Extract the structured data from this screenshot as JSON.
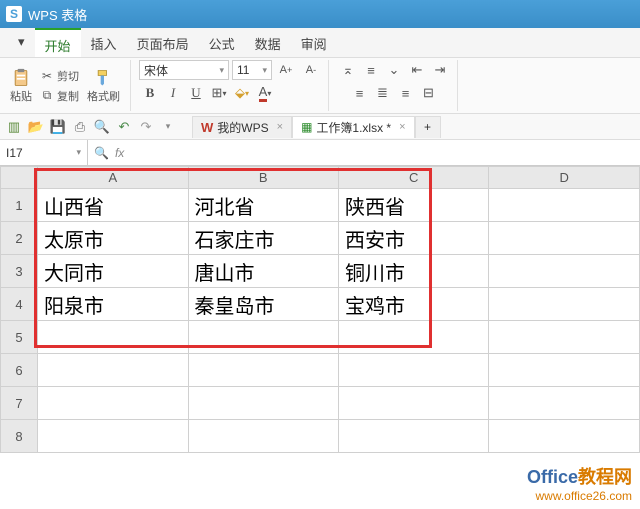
{
  "title": {
    "logo": "S",
    "app": "WPS 表格"
  },
  "menu": {
    "start": "开始",
    "insert": "插入",
    "layout": "页面布局",
    "formula": "公式",
    "data": "数据",
    "review": "审阅"
  },
  "ribbon": {
    "paste": "粘贴",
    "cut": "剪切",
    "copy": "复制",
    "brush": "格式刷",
    "font": "宋体",
    "size": "11",
    "bold": "B",
    "italic": "I",
    "underline": "U",
    "bigA": "A",
    "smallA": "A"
  },
  "quickbar": {
    "mywps": "我的WPS",
    "workbook": "工作簿1.xlsx *",
    "plus": "+"
  },
  "namebox": "I17",
  "fx": "fx",
  "cols": [
    "A",
    "B",
    "C",
    "D"
  ],
  "rows": [
    "1",
    "2",
    "3",
    "4",
    "5",
    "6",
    "7",
    "8"
  ],
  "cells": {
    "r1": {
      "a": "山西省",
      "b": "河北省",
      "c": "陕西省"
    },
    "r2": {
      "a": "太原市",
      "b": "石家庄市",
      "c": "西安市"
    },
    "r3": {
      "a": "大同市",
      "b": "唐山市",
      "c": "铜川市"
    },
    "r4": {
      "a": "阳泉市",
      "b": "秦皇岛市",
      "c": "宝鸡市"
    }
  },
  "watermark": {
    "brand": "Office",
    "suffix": "教程网",
    "url": "www.office26.com"
  },
  "chart_data": {
    "type": "table",
    "columns": [
      "A",
      "B",
      "C"
    ],
    "rows": [
      [
        "山西省",
        "河北省",
        "陕西省"
      ],
      [
        "太原市",
        "石家庄市",
        "西安市"
      ],
      [
        "大同市",
        "唐山市",
        "铜川市"
      ],
      [
        "阳泉市",
        "秦皇岛市",
        "宝鸡市"
      ]
    ]
  }
}
